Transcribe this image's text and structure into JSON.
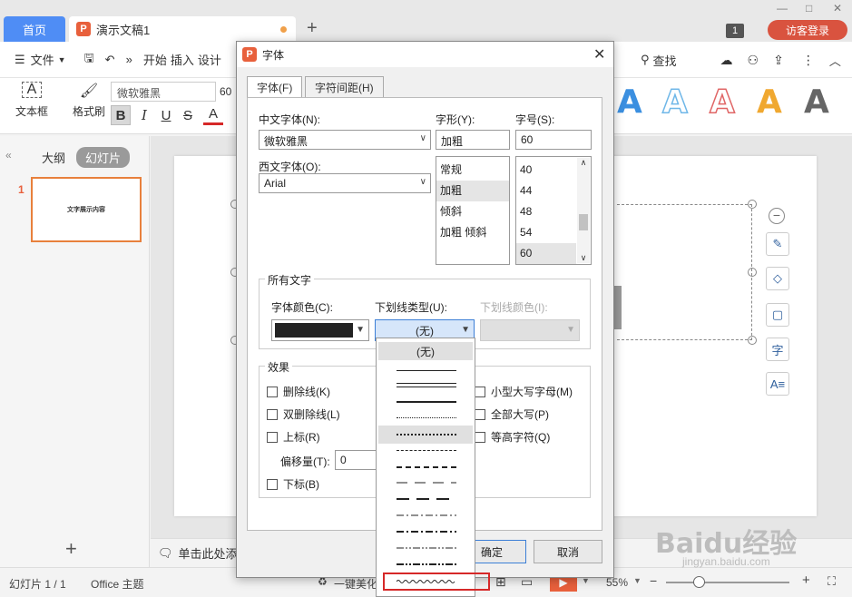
{
  "tabs": {
    "home": "首页",
    "doc": "演示文稿1"
  },
  "header": {
    "badge": "1",
    "visitor_login": "访客登录"
  },
  "menu": {
    "file": "文件",
    "start": "开始",
    "insert": "插入",
    "design": "设计",
    "search": "查找",
    "more": "»"
  },
  "ribbon": {
    "textbox": "文本框",
    "format_brush": "格式刷",
    "font": "微软雅黑",
    "size": "60",
    "bold": "B",
    "italic": "I",
    "underline": "U",
    "strike": "S",
    "fontcolor": "A"
  },
  "styles": [
    {
      "letter": "A",
      "color": "#3b8fe0"
    },
    {
      "letter": "A",
      "color": "#6fb7e8"
    },
    {
      "letter": "A",
      "color": "#e06666"
    },
    {
      "letter": "A",
      "color": "#f0a830"
    },
    {
      "letter": "A",
      "color": "#666666"
    }
  ],
  "left_panel": {
    "outline": "大纲",
    "slides": "幻灯片",
    "slide_number": "1",
    "thumb_text": "文字展示内容"
  },
  "notes": {
    "placeholder": "单击此处添"
  },
  "status": {
    "slide_info": "幻灯片 1 / 1",
    "theme": "Office 主题",
    "beautify": "一键美化",
    "zoom": "55%"
  },
  "dialog": {
    "title": "字体",
    "tabs": [
      "字体(F)",
      "字符间距(H)"
    ],
    "cn_font_label": "中文字体(N):",
    "cn_font_value": "微软雅黑",
    "west_font_label": "西文字体(O):",
    "west_font_value": "Arial",
    "style_label": "字形(Y):",
    "style_value": "加粗",
    "style_options": [
      "常规",
      "加粗",
      "倾斜",
      "加粗 倾斜"
    ],
    "size_label": "字号(S):",
    "size_value": "60",
    "size_options": [
      "40",
      "44",
      "48",
      "54",
      "60"
    ],
    "all_text": "所有文字",
    "color_label": "字体颜色(C):",
    "color_value": "#222222",
    "underline_label": "下划线类型(U):",
    "underline_value": "(无)",
    "underline_color_label": "下划线颜色(I):",
    "effects": "效果",
    "strike": "删除线(K)",
    "double_strike": "双删除线(L)",
    "superscript": "上标(R)",
    "offset_label": "偏移量(T):",
    "offset_value": "0",
    "subscript": "下标(B)",
    "small_caps": "小型大写字母(M)",
    "all_caps": "全部大写(P)",
    "equal_height": "等高字符(Q)",
    "ok": "确定",
    "cancel": "取消"
  },
  "underline_dropdown": {
    "none_option": "(无)"
  },
  "watermark": {
    "main": "Baidu经验",
    "sub": "jingyan.baidu.com"
  }
}
